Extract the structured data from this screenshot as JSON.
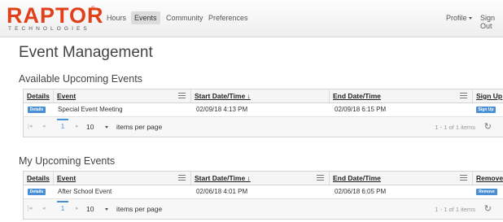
{
  "nav": {
    "logo_text": "RAPTOR",
    "logo_reg": "®",
    "logo_sub": "TECHNOLOGIES",
    "links": [
      "Hours",
      "Events",
      "Community",
      "Preferences"
    ],
    "active_link": "Events",
    "profile": "Profile",
    "sign_out": "Sign Out"
  },
  "page_title": "Event Management",
  "available": {
    "title": "Available Upcoming Events",
    "columns": {
      "details": "Details",
      "event": "Event",
      "start": "Start Date/Time ↓",
      "end": "End Date/Time",
      "action": "Sign Up"
    },
    "rows": [
      {
        "details_btn": "Details",
        "event": "Special Event Meeting",
        "start": "02/09/18 4:13 PM",
        "end": "02/09/18 6:15 PM",
        "action_btn": "Sign Up"
      }
    ],
    "pager": {
      "first": "|◂",
      "prev": "◂",
      "page": "1",
      "next": "▸",
      "last": "▸|",
      "page_size": "10",
      "items_label": "items per page",
      "info": "1 - 1 of 1 items",
      "refresh": "↻"
    }
  },
  "mine": {
    "title": "My Upcoming Events",
    "columns": {
      "details": "Details",
      "event": "Event",
      "start": "Start Date/Time ↓",
      "end": "End Date/Time",
      "action": "Remove"
    },
    "rows": [
      {
        "details_btn": "Details",
        "event": "After School Event",
        "start": "02/06/18 4:01 PM",
        "end": "02/06/18 6:05 PM",
        "action_btn": "Remove"
      }
    ],
    "pager": {
      "first": "|◂",
      "prev": "◂",
      "page": "1",
      "next": "▸",
      "last": "▸|",
      "page_size": "10",
      "items_label": "items per page",
      "info": "1 - 1 of 1 items",
      "refresh": "↻"
    }
  },
  "colors": {
    "brand": "#e0411b",
    "accent": "#4a8fd6"
  }
}
